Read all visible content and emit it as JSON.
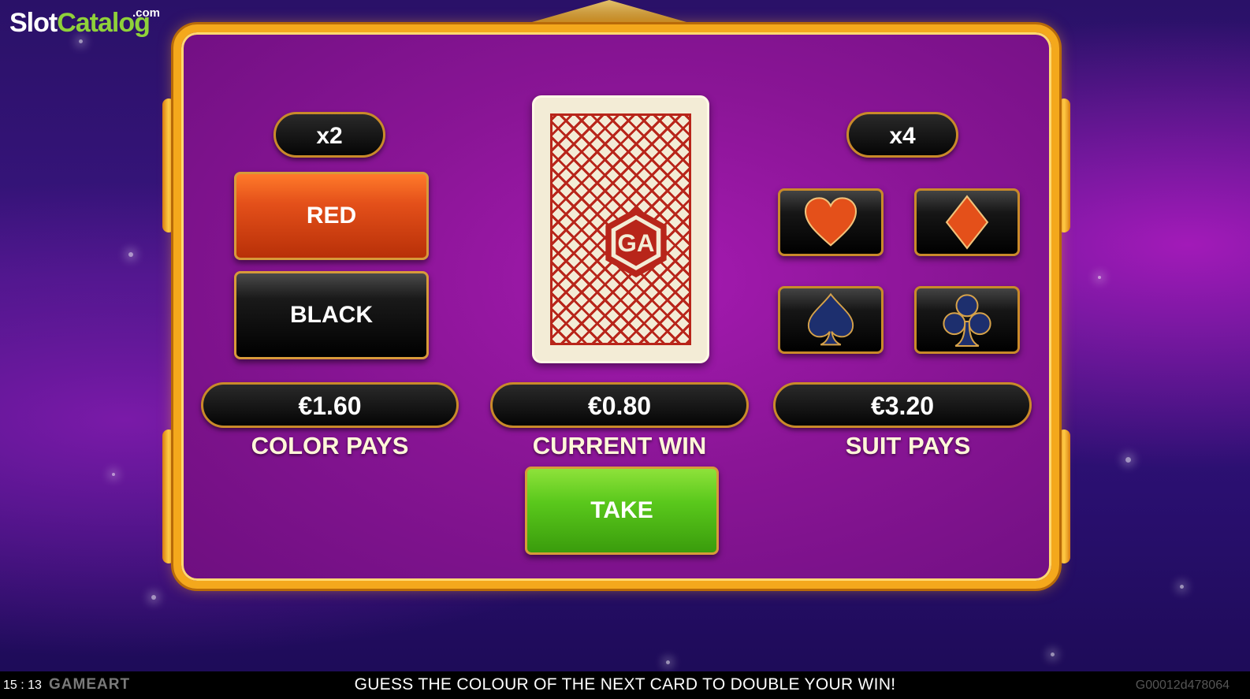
{
  "branding": {
    "logo_slot": "Slot",
    "logo_catalog": "Catalog",
    "logo_com": ".com"
  },
  "color_section": {
    "multiplier": "x2",
    "red_label": "RED",
    "black_label": "BLACK",
    "pays_amount": "€1.60",
    "pays_label": "COLOR PAYS"
  },
  "card": {
    "back_logo": "GA"
  },
  "current": {
    "amount": "€0.80",
    "label": "CURRENT WIN",
    "take_label": "TAKE"
  },
  "suit_section": {
    "multiplier": "x4",
    "suits": [
      "heart",
      "diamond",
      "spade",
      "club"
    ],
    "pays_amount": "€3.20",
    "pays_label": "SUIT PAYS"
  },
  "status_bar": {
    "clock": "15 : 13",
    "provider": "GAMEART",
    "message": "GUESS THE COLOUR OF THE NEXT CARD TO DOUBLE YOUR WIN!",
    "game_id": "G00012d478064"
  },
  "colors": {
    "frame": "#f4a81c",
    "red": "#e4501a",
    "green": "#5ac81c",
    "navy_suit": "#1d2f6e"
  }
}
